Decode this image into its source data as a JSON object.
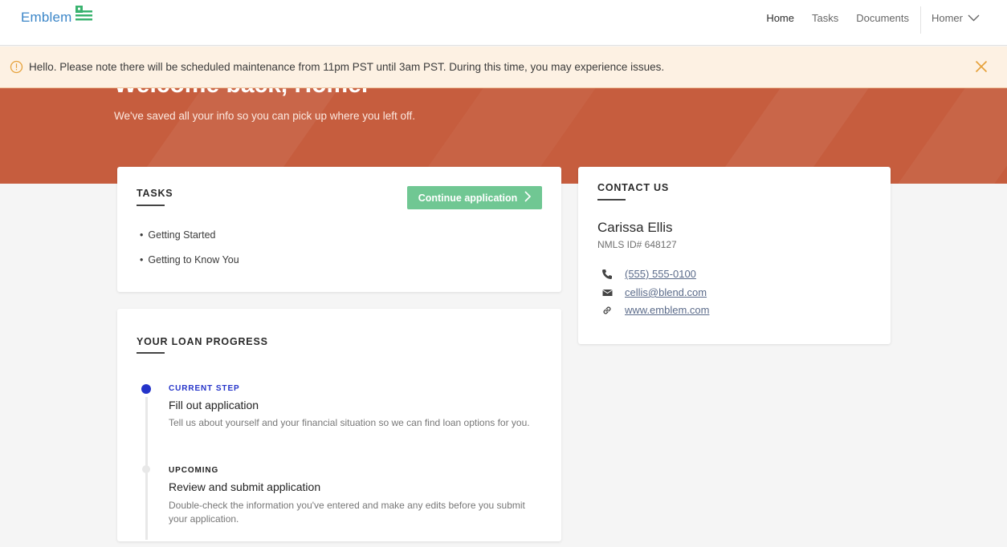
{
  "nav": {
    "logo": "Emblem",
    "links": [
      "Home",
      "Tasks",
      "Documents"
    ],
    "user": "Homer"
  },
  "banner": {
    "message": "Hello. Please note there will be scheduled maintenance from 11pm PST until 3am PST. During this time, you may experience issues."
  },
  "hero": {
    "title": "Welcome back, Homer",
    "subtitle": "We've saved all your info so you can pick up where you left off."
  },
  "tasks": {
    "heading": "TASKS",
    "button": "Continue application",
    "items": [
      "Getting Started",
      "Getting to Know You"
    ]
  },
  "progress": {
    "heading": "YOUR LOAN PROGRESS",
    "steps": [
      {
        "status": "CURRENT STEP",
        "title": "Fill out application",
        "description": "Tell us about yourself and your financial situation so we can find loan options for you."
      },
      {
        "status": "UPCOMING",
        "title": "Review and submit application",
        "description": "Double-check the information you've entered and make any edits before you submit your application."
      }
    ]
  },
  "contact": {
    "heading": "CONTACT US",
    "name": "Carissa Ellis",
    "nmls": "NMLS ID# 648127",
    "phone": "(555) 555-0100",
    "email": "cellis@blend.com",
    "website": "www.emblem.com"
  },
  "colors": {
    "brand_blue": "#3b86c8",
    "logo_green": "#3ab36f",
    "hero": "#c65d3e",
    "button_green": "#70c793",
    "step_current": "#2433c9",
    "banner_bg": "#fdf1e3",
    "warning": "#e6a23c"
  },
  "icons": [
    "logo-flag-icon",
    "chevron-down-icon",
    "warning-circle-icon",
    "close-icon",
    "chevron-right-icon",
    "phone-icon",
    "email-icon",
    "link-icon"
  ]
}
